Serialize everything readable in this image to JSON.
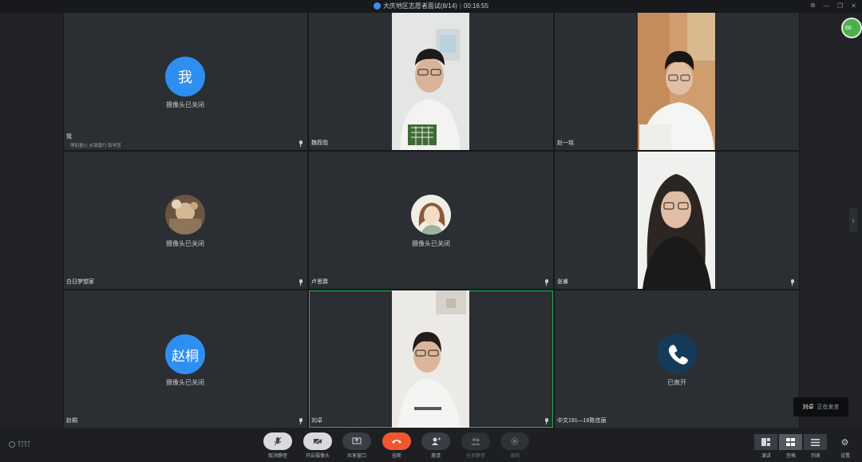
{
  "window": {
    "title": "大庆地区志愿者面试(8/14)",
    "sep": "|",
    "elapsed": "00:16:55"
  },
  "status_text": "摄像头已关闭",
  "participants": [
    {
      "name": "我",
      "avatar_text": "我",
      "sub": "博丽童心 乡镇雷行 助学团"
    },
    {
      "name": "魏荐勋"
    },
    {
      "name": "赵一铭"
    },
    {
      "name": "白日梦想家"
    },
    {
      "name": "卢思霖"
    },
    {
      "name": "张睿"
    },
    {
      "name": "赵桐",
      "avatar_text": "赵桐"
    },
    {
      "name": "刘卓"
    },
    {
      "name": "中文191—16陈佳丽",
      "status": "已离开"
    }
  ],
  "side_badge": "66",
  "speaking": {
    "name": "刘卓",
    "status": "正在发言"
  },
  "toolbar": {
    "logo": "钉钉",
    "buttons": [
      {
        "label": "取消静音",
        "icon": "mic-muted-icon"
      },
      {
        "label": "开启摄像头",
        "icon": "camera-off-icon"
      },
      {
        "label": "共享窗口",
        "icon": "screen-share-icon"
      },
      {
        "label": "挂断",
        "icon": "hang-up-icon",
        "color": "#f0572c"
      },
      {
        "label": "邀请",
        "icon": "add-person-icon"
      },
      {
        "label": "全员静音",
        "icon": "mute-all-icon"
      },
      {
        "label": "录制",
        "icon": "record-icon"
      }
    ],
    "views": [
      {
        "label": "演讲"
      },
      {
        "label": "宫格"
      },
      {
        "label": "列表"
      },
      {
        "label": "设置"
      }
    ]
  }
}
